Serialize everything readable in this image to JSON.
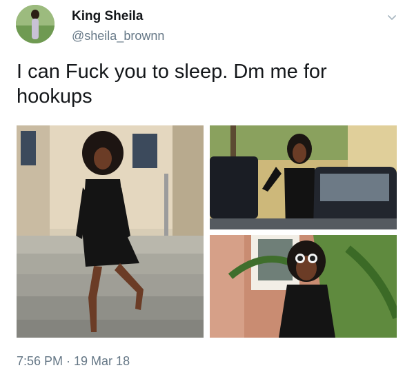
{
  "user": {
    "display_name": "King Sheila",
    "handle": "@sheila_brownn",
    "avatar_icon": "profile-photo"
  },
  "tweet": {
    "text": "I can Fuck you to sleep. Dm me for hookups",
    "timestamp": "7:56 PM · 19 Mar 18"
  },
  "menu": {
    "icon": "chevron-down-icon"
  },
  "media": [
    {
      "label": "photo-steps"
    },
    {
      "label": "photo-car"
    },
    {
      "label": "photo-sunglasses"
    }
  ],
  "colors": {
    "text": "#14171a",
    "secondary": "#657786",
    "chevron": "#aab8c2"
  }
}
